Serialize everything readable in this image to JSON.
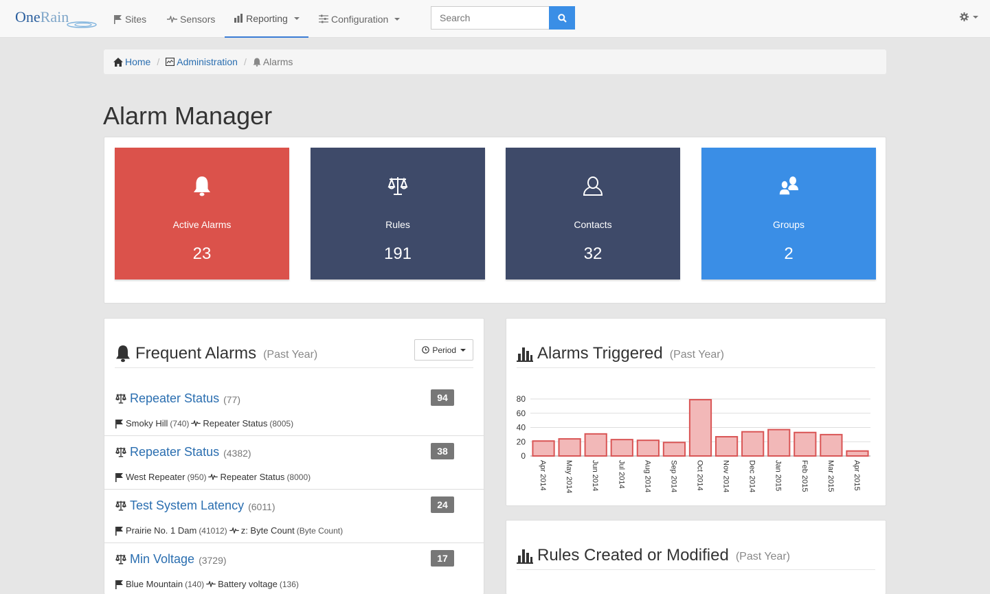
{
  "nav": {
    "logo_one": "One",
    "logo_rain": "Rain",
    "items": [
      {
        "label": "Sites"
      },
      {
        "label": "Sensors"
      },
      {
        "label": "Reporting"
      },
      {
        "label": "Configuration"
      }
    ],
    "search_placeholder": "Search"
  },
  "breadcrumb": {
    "home": "Home",
    "admin": "Administration",
    "current": "Alarms"
  },
  "page_title": "Alarm Manager",
  "tiles": [
    {
      "label": "Active Alarms",
      "value": "23",
      "color": "#db524b",
      "icon": "bell-icon"
    },
    {
      "label": "Rules",
      "value": "191",
      "color": "#3e4a69",
      "icon": "scale-icon"
    },
    {
      "label": "Contacts",
      "value": "32",
      "color": "#3e4a69",
      "icon": "user-icon"
    },
    {
      "label": "Groups",
      "value": "2",
      "color": "#3a8ee6",
      "icon": "users-icon"
    }
  ],
  "frequent": {
    "title": "Frequent Alarms",
    "subtitle": "(Past Year)",
    "period_label": "Period",
    "items": [
      {
        "name": "Repeater Status",
        "id": "(77)",
        "count": "94",
        "site": "Smoky Hill",
        "site_id": "(740)",
        "sensor": "Repeater Status",
        "sensor_id": "(8005)"
      },
      {
        "name": "Repeater Status",
        "id": "(4382)",
        "count": "38",
        "site": "West Repeater",
        "site_id": "(950)",
        "sensor": "Repeater Status",
        "sensor_id": "(8000)"
      },
      {
        "name": "Test System Latency",
        "id": "(6011)",
        "count": "24",
        "site": "Prairie No. 1 Dam",
        "site_id": "(41012)",
        "sensor": "z: Byte Count",
        "sensor_id": "(Byte Count)"
      },
      {
        "name": "Min Voltage",
        "id": "(3729)",
        "count": "17",
        "site": "Blue Mountain",
        "site_id": "(140)",
        "sensor": "Battery voltage",
        "sensor_id": "(136)"
      }
    ]
  },
  "alarms_triggered": {
    "title": "Alarms Triggered",
    "subtitle": "(Past Year)"
  },
  "rules_created": {
    "title": "Rules Created or Modified",
    "subtitle": "(Past Year)"
  },
  "chart_data": {
    "type": "bar",
    "categories": [
      "Apr 2014",
      "May 2014",
      "Jun 2014",
      "Jul 2014",
      "Aug 2014",
      "Sep 2014",
      "Oct 2014",
      "Nov 2014",
      "Dec 2014",
      "Jan 2015",
      "Feb 2015",
      "Mar 2015",
      "Apr 2015"
    ],
    "values": [
      21,
      24,
      31,
      23,
      22,
      19,
      79,
      27,
      34,
      37,
      33,
      30,
      7
    ],
    "yticks": [
      0,
      20,
      40,
      60,
      80
    ],
    "ylim": [
      0,
      80
    ],
    "grid": true,
    "bar_fill": "#f2b8b8",
    "bar_stroke": "#d95555"
  }
}
